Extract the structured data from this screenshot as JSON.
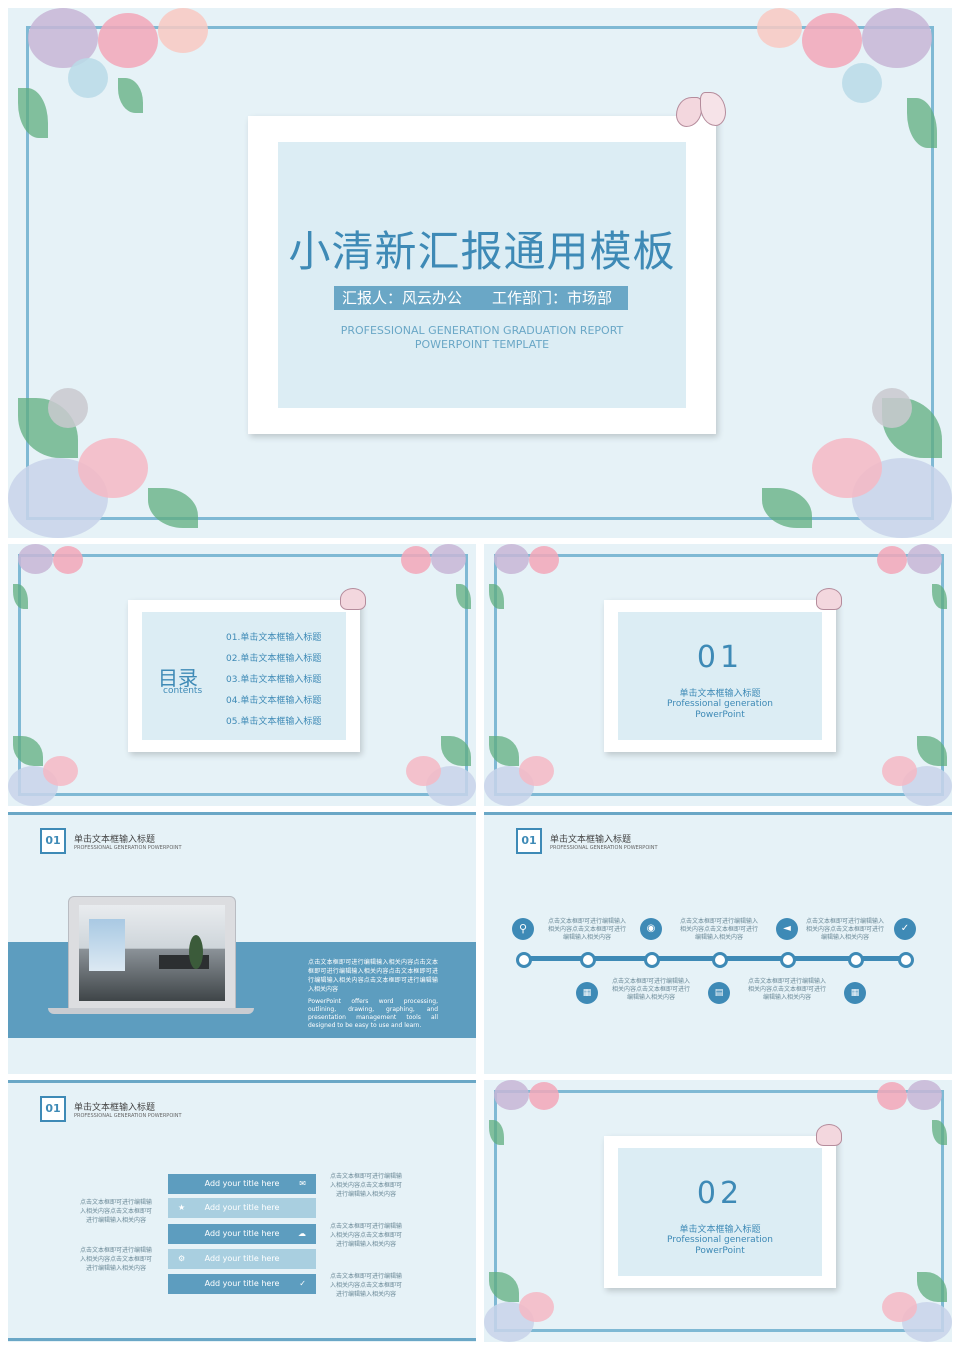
{
  "slide1": {
    "title": "小清新汇报通用模板",
    "reporter": "汇报人：风云办公",
    "dept": "工作部门：市场部",
    "en1": "PROFESSIONAL GENERATION GRADUATION REPORT",
    "en2": "POWERPOINT TEMPLATE"
  },
  "toc": {
    "title": "目录",
    "subtitle": "contents",
    "items": [
      "01.单击文本框输入标题",
      "02.单击文本框输入标题",
      "03.单击文本框输入标题",
      "04.单击文本框输入标题",
      "05.单击文本框输入标题"
    ]
  },
  "section1": {
    "num": "01",
    "title": "单击文本框输入标题",
    "en1": "Professional generation",
    "en2": "PowerPoint"
  },
  "section2": {
    "num": "02",
    "title": "单击文本框输入标题",
    "en1": "Professional generation",
    "en2": "PowerPoint"
  },
  "header": {
    "num": "01",
    "title": "单击文本框输入标题",
    "sub": "PROFESSIONAL GENERATION POWERPOINT"
  },
  "laptop": {
    "cn": "点击文本框即可进行编辑输入相关内容点击文本框即可进行编辑输入相关内容点击文本框即可进行编辑输入相关内容点击文本框即可进行编辑输入相关内容",
    "en": "PowerPoint offers word processing, outlining, drawing, graphing, and presentation management tools all designed to be easy to use and learn."
  },
  "timeline": {
    "top_text": "点击文本框即可进行编辑输入相关内容点击文本框即可进行编辑输入相关内容",
    "bottom_text": "点击文本框即可进行编辑输入相关内容点击文本框即可进行编辑输入相关内容"
  },
  "bars": {
    "labels": [
      "Add your title here",
      "Add your title here",
      "Add your title here",
      "Add your title here",
      "Add your title here"
    ],
    "right_text": "点击文本框即可进行编辑输入相关内容点击文本框即可进行编辑输入相关内容",
    "left_text": "点击文本框即可进行编辑输入相关内容点击文本框即可进行编辑输入相关内容"
  }
}
